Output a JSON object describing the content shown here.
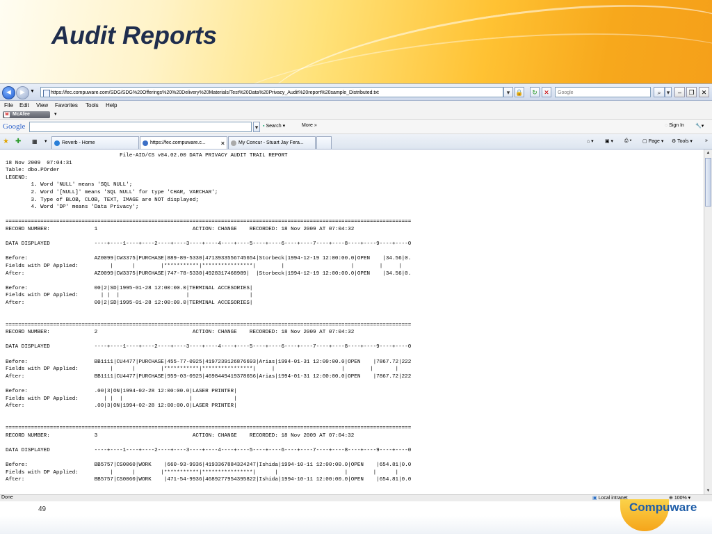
{
  "slide": {
    "title": "Audit Reports",
    "page_number": "49",
    "logo": "Compuware"
  },
  "browser": {
    "back_glyph": "◄",
    "forward_glyph": "►",
    "url": "https://fec.compuware.com/SDG/SDG%20Offerings%20%20Delivery%20Materials/Test%20Data%20Privacy_Audit%20report%20sample_Distributed.txt",
    "search_placeholder": "Google",
    "menu": [
      "File",
      "Edit",
      "View",
      "Favorites",
      "Tools",
      "Help"
    ],
    "mcafee_label": "McAfee",
    "google_logo": "Google",
    "google_search_label": "Search",
    "google_more_label": "More »",
    "google_signin_label": "Sign In",
    "tabs": [
      {
        "label": "Reverb - Home",
        "active": false
      },
      {
        "label": "https://fec.compuware.c...",
        "active": true
      },
      {
        "label": "My Concur - Stuart Jay Fera...",
        "active": false
      }
    ],
    "commands": {
      "page": "Page",
      "tools": "Tools"
    },
    "status": {
      "left": "Done",
      "zone": "Local intranet",
      "zoom": "100%"
    }
  },
  "report_lines": [
    "                                    File-AID/CS v04.02.00 DATA PRIVACY AUDIT TRAIL REPORT",
    "18 Nov 2009  07:04:31",
    "Table: dbo.POrder",
    "LEGEND:",
    "        1. Word 'NULL' means 'SQL NULL';",
    "        2. Word '[NULL]' means 'SQL NULL' for type 'CHAR, VARCHAR';",
    "        3. Type of BLOB, CLOB, TEXT, IMAGE are NOT displayed;",
    "        4. Word 'DP' means 'Data Privacy';",
    "",
    "================================================================================================================================",
    "RECORD NUMBER:              1                              ACTION: CHANGE    RECORDED: 18 Nov 2009 AT 07:04:32",
    "",
    "DATA DISPLAYED              ----+----1----+----2----+----3----+----4----+----5----+----6----+----7----+----8----+----9----+----0",
    "",
    "Before:                     AZ0099|CW3375|PURCHASE|889-89-5330|4713933556745654|Storbeck|1994-12-19 12:00:00.0|OPEN    |34.56|0.",
    "Fields with DP Applied:          |      |        |***********|****************|        |                     |        |     |",
    "After:                      AZ0099|CW3375|PURCHASE|747-78-5330|4928317468989|  |Storbeck|1994-12-19 12:00:00.0|OPEN    |34.56|0.",
    "",
    "Before:                     00|2|SD|1995-01-28 12:00:00.0|TERMINAL ACCESORIES|",
    "Fields with DP Applied:       | |  |                     |                   |",
    "After:                      00|2|SD|1995-01-28 12:00:00.0|TERMINAL ACCESORIES|",
    "",
    "",
    "================================================================================================================================",
    "RECORD NUMBER:              2                              ACTION: CHANGE    RECORDED: 18 Nov 2009 AT 07:04:32",
    "",
    "DATA DISPLAYED              ----+----1----+----2----+----3----+----4----+----5----+----6----+----7----+----8----+----9----+----0",
    "",
    "Before:                     BB1111|CU4477|PURCHASE|455-77-0925|4197239126876693|Arias|1994-01-31 12:00:00.0|OPEN    |7867.72|222",
    "Fields with DP Applied:          |      |        |***********|****************|     |                     |        |       |",
    "After:                      BB1111|CU4477|PURCHASE|959-03-0925|4698449419378656|Arias|1994-01-31 12:00:00.0|OPEN    |7867.72|222",
    "",
    "Before:                     .00|3|ON|1994-02-28 12:00:00.0|LASER PRINTER|",
    "Fields with DP Applied:        | |  |                     |             |",
    "After:                      .00|3|ON|1994-02-28 12:00:00.0|LASER PRINTER|",
    "",
    "",
    "================================================================================================================================",
    "RECORD NUMBER:              3                              ACTION: CHANGE    RECORDED: 18 Nov 2009 AT 07:04:32",
    "",
    "DATA DISPLAYED              ----+----1----+----2----+----3----+----4----+----5----+----6----+----7----+----8----+----9----+----0",
    "",
    "Before:                     BB5757|CS0060|WORK    |660-93-9936|4193367884324247|Ishida|1994-10-11 12:00:00.0|OPEN    |654.81|0.0",
    "Fields with DP Applied:          |      |        |***********|****************|      |                     |        |      |",
    "After:                      BB5757|CS0060|WORK    |471-54-9936|4689277954395822|Ishida|1994-10-11 12:00:00.0|OPEN    |654.81|0.0"
  ]
}
